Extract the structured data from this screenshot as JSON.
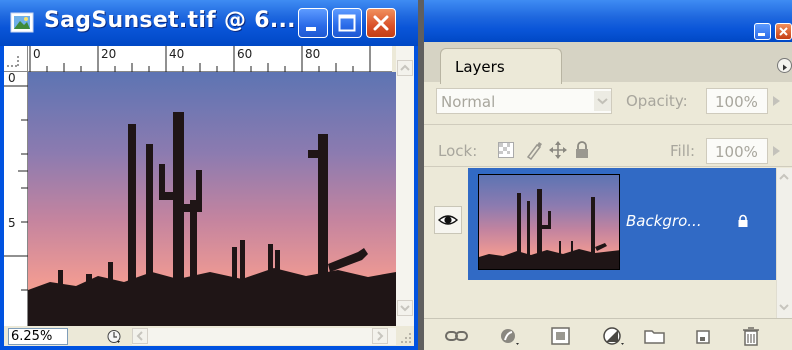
{
  "document": {
    "title": "SagSunset.tif @ 6....",
    "zoom": "6.25%",
    "ruler_h_labels": [
      "0",
      "20",
      "40",
      "60",
      "80"
    ],
    "ruler_v_labels": [
      "0",
      "5"
    ]
  },
  "layers_panel": {
    "tab_label": "Layers",
    "blend_mode": "Normal",
    "opacity_label": "Opacity:",
    "opacity_value": "100%",
    "lock_label": "Lock:",
    "fill_label": "Fill:",
    "fill_value": "100%",
    "layer": {
      "name": "Backgro...",
      "visible": true,
      "locked": true
    }
  },
  "colors": {
    "titlebar_blue": "#0a55d8",
    "selection_blue": "#316ac5",
    "close_red": "#d9512a",
    "panel_bg": "#ece9d8"
  },
  "icons": {
    "document": "photoshop-document-icon",
    "eye": "visibility-eye-icon",
    "lock": "lock-icon",
    "panel_footer": [
      "link-layers-icon",
      "layer-style-icon",
      "layer-mask-icon",
      "adjustment-layer-icon",
      "new-group-icon",
      "new-layer-icon",
      "trash-icon"
    ]
  }
}
